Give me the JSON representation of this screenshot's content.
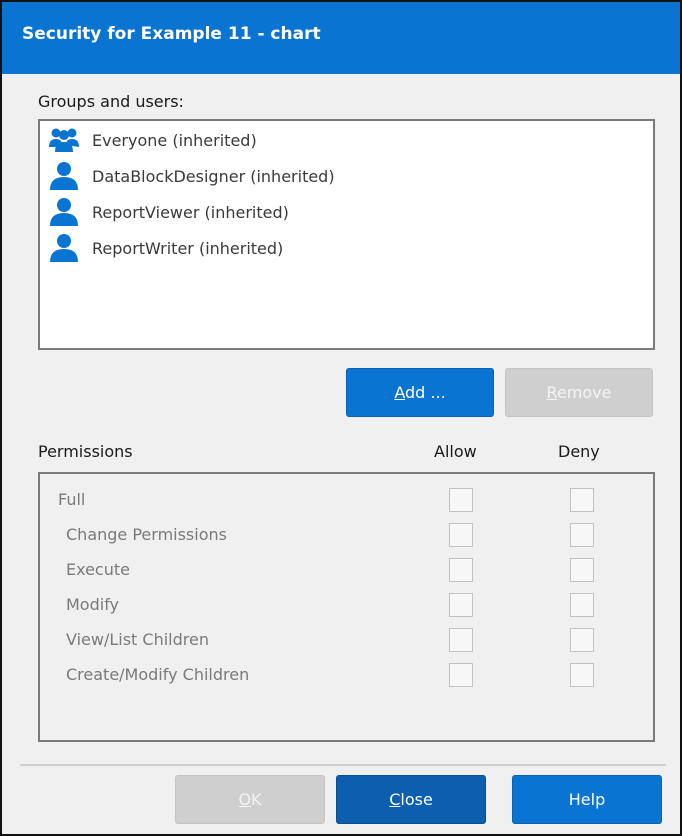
{
  "dialog": {
    "title": "Security for Example 11 - chart"
  },
  "groups": {
    "label": "Groups and users:",
    "items": [
      {
        "name": "Everyone (inherited)",
        "icon": "group-icon"
      },
      {
        "name": "DataBlockDesigner (inherited)",
        "icon": "user-icon"
      },
      {
        "name": "ReportViewer (inherited)",
        "icon": "user-icon"
      },
      {
        "name": "ReportWriter (inherited)",
        "icon": "user-icon"
      }
    ]
  },
  "buttons": {
    "add": {
      "before": "",
      "mnemonic": "A",
      "after": "dd ..."
    },
    "remove": {
      "before": "",
      "mnemonic": "R",
      "after": "emove"
    },
    "ok": {
      "before": "",
      "mnemonic": "O",
      "after": "K"
    },
    "close": {
      "before": "",
      "mnemonic": "C",
      "after": "lose"
    },
    "help": "Help"
  },
  "permissions": {
    "label": "Permissions",
    "allow_label": "Allow",
    "deny_label": "Deny",
    "items": [
      {
        "name": "Full",
        "allow": false,
        "deny": false
      },
      {
        "name": "Change Permissions",
        "allow": false,
        "deny": false
      },
      {
        "name": "Execute",
        "allow": false,
        "deny": false
      },
      {
        "name": "Modify",
        "allow": false,
        "deny": false
      },
      {
        "name": "View/List Children",
        "allow": false,
        "deny": false
      },
      {
        "name": "Create/Modify Children",
        "allow": false,
        "deny": false
      }
    ]
  },
  "colors": {
    "accent": "#0a74d2",
    "disabled_button": "#cfcfcf"
  }
}
